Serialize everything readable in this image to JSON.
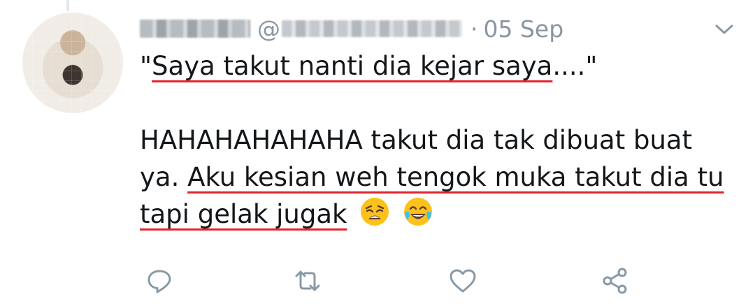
{
  "tweet": {
    "author": {
      "display_name_blurred": true,
      "handle_prefix": "@",
      "handle_blurred": true
    },
    "separator": "·",
    "date": "05 Sep",
    "lines": [
      {
        "parts": [
          {
            "text": "\"",
            "underline": false
          },
          {
            "text": "Saya takut nanti dia kejar saya",
            "underline": true
          },
          {
            "text": "....\"",
            "underline": false
          }
        ]
      },
      {
        "parts": []
      },
      {
        "parts": [
          {
            "text": "HAHAHAHAHAHA takut dia tak dibuat buat",
            "underline": false
          }
        ]
      },
      {
        "parts": [
          {
            "text": "ya. ",
            "underline": false
          },
          {
            "text": "Aku kesian weh tengok muka takut dia tu",
            "underline": true
          }
        ]
      },
      {
        "parts": [
          {
            "text": "tapi gelak jugak",
            "underline": true
          },
          {
            "text": " ",
            "underline": false
          }
        ]
      }
    ],
    "emojis": [
      "weary-face-emoji",
      "tears-of-joy-emoji"
    ]
  },
  "actions": [
    "reply-icon",
    "retweet-icon",
    "like-icon",
    "share-icon"
  ],
  "colors": {
    "text": "#14171a",
    "secondary": "#8a96a3",
    "underline": "#e0242c",
    "icon": "#8899a6"
  }
}
